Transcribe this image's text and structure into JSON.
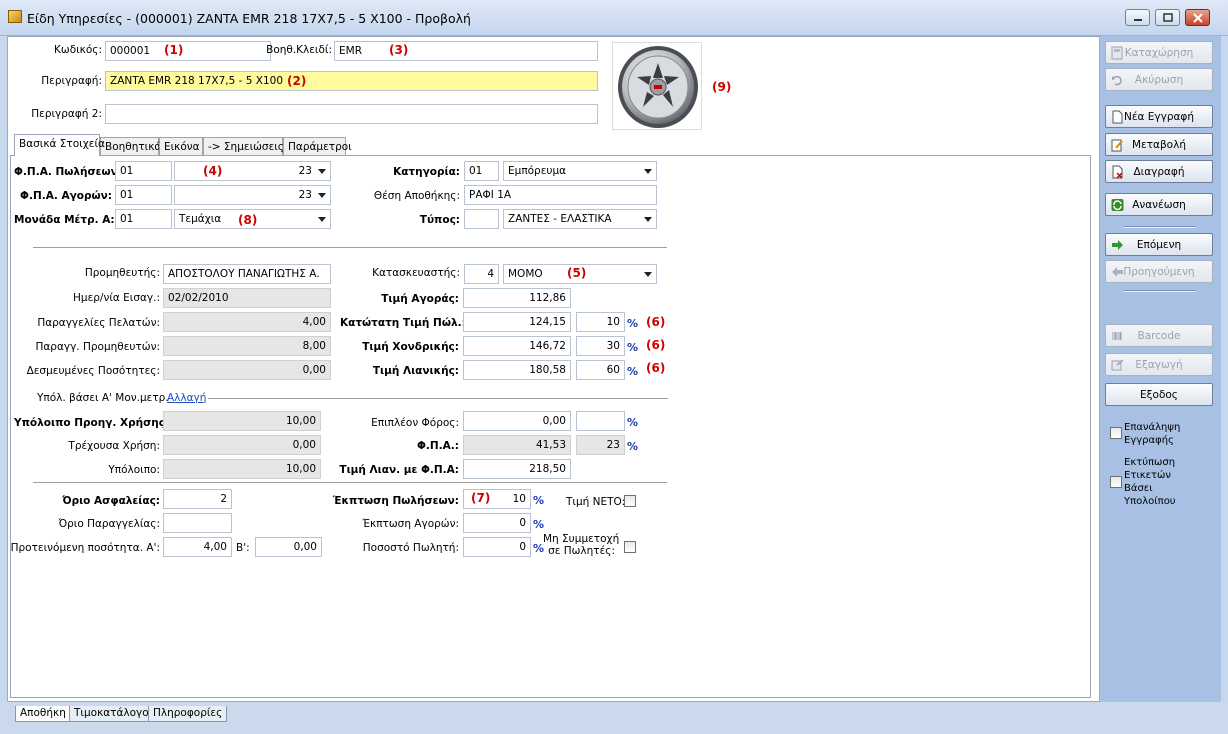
{
  "window": {
    "title": "Είδη Υπηρεσίες - (000001) ZANTA EMR 218 17X7,5 - 5 X100 -  Προβολή"
  },
  "header": {
    "code_label": "Κωδικός:",
    "code_value": "000001",
    "aux_key_label": "Βοηθ.Κλειδί:",
    "aux_key_value": "EMR",
    "description_label": "Περιγραφή:",
    "description_value": "ZANTA EMR 218 17X7,5 - 5 X100",
    "description2_label": "Περιγραφή 2:",
    "description2_value": ""
  },
  "markers": {
    "m1": "(1)",
    "m2": "(2)",
    "m3": "(3)",
    "m4": "(4)",
    "m5": "(5)",
    "m6a": "(6)",
    "m6b": "(6)",
    "m6c": "(6)",
    "m7": "(7)",
    "m8": "(8)",
    "m9": "(9)"
  },
  "tabs": [
    "Βασικά Στοιχεία",
    "Βοηθητικά",
    "Εικόνα",
    "-> Σημειώσεις",
    "Παράμετροι"
  ],
  "basic": {
    "vat_sales_label": "Φ.Π.Α. Πωλήσεων:",
    "vat_sales_code": "01",
    "vat_sales_rate": "23",
    "vat_purch_label": "Φ.Π.Α. Αγορών:",
    "vat_purch_code": "01",
    "vat_purch_rate": "23",
    "unit_label": "Μονάδα Μέτρ. Α:",
    "unit_code": "01",
    "unit_name": "Τεμάχια",
    "category_label": "Κατηγορία:",
    "category_code": "01",
    "category_name": "Εμπόρευμα",
    "location_label": "Θέση Αποθήκης:",
    "location_value": "ΡΑΦΙ 1Α",
    "type_label": "Τύπος:",
    "type_code": "",
    "type_name": "ΖΑΝΤΕΣ - ΕΛΑΣΤΙΚΑ"
  },
  "supply": {
    "supplier_label": "Προμηθευτής:",
    "supplier_value": "ΑΠΟΣΤΟΛΟΥ ΠΑΝΑΓΙΩΤΗΣ Α.",
    "entry_date_label": "Ημερ/νία Εισαγ.:",
    "entry_date_value": "02/02/2010",
    "cust_orders_label": "Παραγγελίες Πελατών:",
    "cust_orders_value": "4,00",
    "supp_orders_label": "Παραγγ. Προμηθευτών:",
    "supp_orders_value": "8,00",
    "reserved_label": "Δεσμευμένες Ποσότητες:",
    "reserved_value": "0,00",
    "manufacturer_label": "Κατασκευαστής:",
    "manufacturer_code": "4",
    "manufacturer_name": "ΜΟΜΟ",
    "purchase_price_label": "Τιμή Αγοράς:",
    "purchase_price_value": "112,86",
    "min_price_label": "Κατώτατη Τιμή Πώλ.:",
    "min_price_value": "124,15",
    "min_price_pct": "10",
    "wholesale_label": "Τιμή Χονδρικής:",
    "wholesale_value": "146,72",
    "wholesale_pct": "30",
    "retail_label": "Τιμή Λιανικής:",
    "retail_value": "180,58",
    "retail_pct": "60",
    "pct_symbol": "%"
  },
  "balance": {
    "section_label": "Υπόλ. βάσει Α' Μον.μετρ.",
    "change_link": "Αλλαγή",
    "prev_year_label": "Υπόλοιπο Προηγ. Χρήσης:",
    "prev_year_value": "10,00",
    "current_year_label": "Τρέχουσα Χρήση:",
    "current_year_value": "0,00",
    "balance_label": "Υπόλοιπο:",
    "balance_value": "10,00",
    "extra_tax_label": "Επιπλέον Φόρος:",
    "extra_tax_value": "0,00",
    "extra_tax_pct": "",
    "vat_label": "Φ.Π.Α.:",
    "vat_value": "41,53",
    "vat_pct": "23",
    "retail_vat_label": "Τιμή Λιαν. με Φ.Π.Α:",
    "retail_vat_value": "218,50"
  },
  "limits": {
    "safety_label": "Όριο Ασφαλείας:",
    "safety_value": "2",
    "order_limit_label": "Όριο Παραγγελίας:",
    "order_limit_value": "",
    "suggested_label": "Προτεινόμενη ποσότητα. Α':",
    "suggested_a_value": "4,00",
    "suggested_b_label": "Β':",
    "suggested_b_value": "0,00",
    "sales_discount_label": "Έκπτωση Πωλήσεων:",
    "sales_discount_value": "10",
    "purchase_discount_label": "Έκπτωση Αγορών:",
    "purchase_discount_value": "0",
    "salesman_pct_label": "Ποσοστό Πωλητή:",
    "salesman_pct_value": "0",
    "net_price_label": "Τιμή  ΝΕΤΟ:",
    "no_salesman_label_1": "Μη Συμμετοχή",
    "no_salesman_label_2": "σε Πωλητές:"
  },
  "actions": {
    "save": "Καταχώρηση",
    "cancel": "Ακύρωση",
    "new": "Νέα Εγγραφή",
    "edit": "Μεταβολή",
    "delete": "Διαγραφή",
    "refresh": "Ανανέωση",
    "next": "Επόμενη",
    "previous": "Προηγούμενη",
    "barcode": "Barcode",
    "export": "Εξαγωγή",
    "exit": "Εξοδος",
    "repeat_l1": "Επανάληψη",
    "repeat_l2": "Εγγραφής",
    "print_l1": "Εκτύπωση",
    "print_l2": "Ετικετών",
    "print_l3": "Βάσει",
    "print_l4": "Υπολοίπου"
  },
  "bottom_tabs": [
    "Αποθήκη",
    "Τιμοκατάλογοι",
    "Πληροφορίες"
  ],
  "icons": {
    "app": "box-icon",
    "minimize": "minimize-icon",
    "maximize": "maximize-icon",
    "close": "close-icon",
    "product_image": "wheel-rim-image"
  },
  "colors": {
    "highlight_field": "#fffb9c",
    "marker_red": "#d00000",
    "panel_blue": "#a7c0e3"
  }
}
